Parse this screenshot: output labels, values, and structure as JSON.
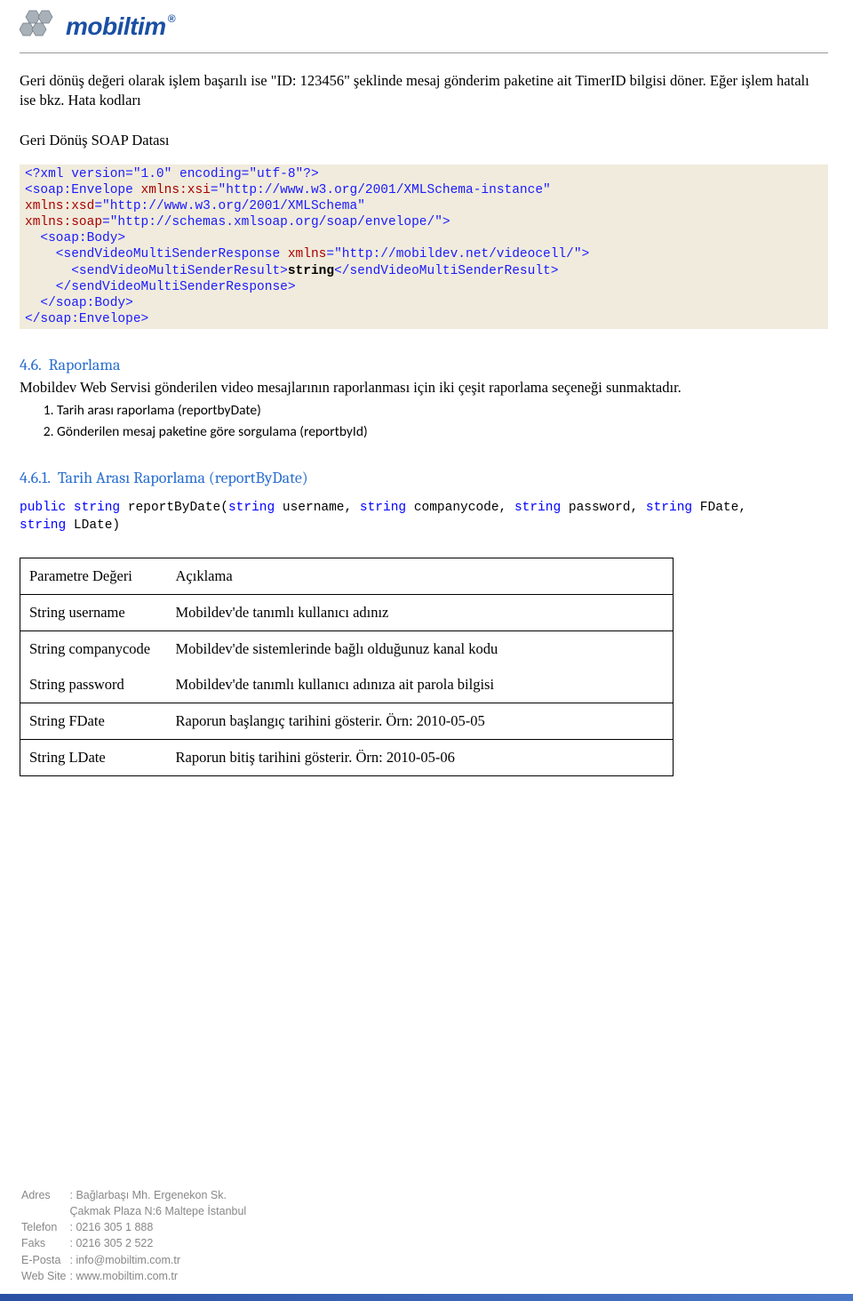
{
  "logo": {
    "text": "mobiltim",
    "reg": "®"
  },
  "intro_para": "Geri dönüş değeri olarak işlem başarılı ise \"ID: 123456\" şeklinde mesaj gönderim paketine ait TimerID bilgisi döner. Eğer işlem hatalı ise bkz. Hata kodları",
  "soap_heading": "Geri Dönüş SOAP Datası",
  "soap_code": {
    "t0": "<?xml version=\"1.0\" encoding=\"utf-8\"?>",
    "t1a": "<soap:Envelope ",
    "t1_attr1": "xmlns:xsi",
    "t1_eq": "=\"",
    "t1_v1": "http://www.w3.org/2001/XMLSchema-instance",
    "t1_q": "\"",
    "t1_attr2": "xmlns:xsd",
    "t1_v2": "http://www.w3.org/2001/XMLSchema",
    "t1_attr3": "xmlns:soap",
    "t1_v3": "http://schemas.xmlsoap.org/soap/envelope/",
    "t2": "  <soap:Body>",
    "t3a": "    <sendVideoMultiSenderResponse ",
    "t3_attr": "xmlns",
    "t3_v": "http://mobildev.net/videocell/",
    "t4a": "      <sendVideoMultiSenderResult>",
    "t4b": "string",
    "t4c": "</sendVideoMultiSenderResult>",
    "t5": "    </sendVideoMultiSenderResponse>",
    "t6": "  </soap:Body>",
    "t7": "</soap:Envelope>"
  },
  "h46": {
    "num": "4.6.",
    "title": "Raporlama"
  },
  "h46_text": "Mobildev Web Servisi gönderilen video mesajlarının raporlanması için iki çeşit raporlama seçeneği sunmaktadır.",
  "list_items": [
    "Tarih arası raporlama (reportbyDate)",
    "Gönderilen mesaj paketine göre sorgulama (reportbyId)"
  ],
  "h461": {
    "num": "4.6.1.",
    "title": "Tarih Arası Raporlama (reportByDate)"
  },
  "sig": {
    "public": "public",
    "string1": "string",
    "method": " reportByDate(",
    "p1t": "string",
    "p1n": " username, ",
    "p2t": "string",
    "p2n": " companycode, ",
    "p3t": "string",
    "p3n": " password, ",
    "p4t": "string",
    "p4n": " FDate,",
    "p5t": "string",
    "p5n": " LDate)"
  },
  "table": {
    "h1": "Parametre Değeri",
    "h2": "Açıklama",
    "rows": [
      {
        "p": "String username",
        "d": "Mobildev'de tanımlı kullanıcı adınız"
      },
      {
        "p": "String companycode",
        "d": "Mobildev'de sistemlerinde bağlı olduğunuz kanal kodu"
      },
      {
        "p": "String password",
        "d": "Mobildev'de tanımlı kullanıcı adınıza ait parola bilgisi"
      },
      {
        "p": "String FDate",
        "d": "Raporun başlangıç tarihini gösterir. Örn: 2010-05-05"
      },
      {
        "p": "String LDate",
        "d": "Raporun bitiş tarihini gösterir. Örn: 2010-05-06"
      }
    ]
  },
  "footer": {
    "adres_l": "Adres",
    "adres_v1": ": Bağlarbaşı Mh. Ergenekon Sk.",
    "adres_v2": "  Çakmak Plaza N:6 Maltepe İstanbul",
    "tel_l": "Telefon",
    "tel_v": ": 0216 305 1 888",
    "faks_l": "Faks",
    "faks_v": ": 0216 305 2 522",
    "eposta_l": "E-Posta",
    "eposta_v": ": info@mobiltim.com.tr",
    "web_l": "Web Site",
    "web_v": ": www.mobiltim.com.tr"
  }
}
